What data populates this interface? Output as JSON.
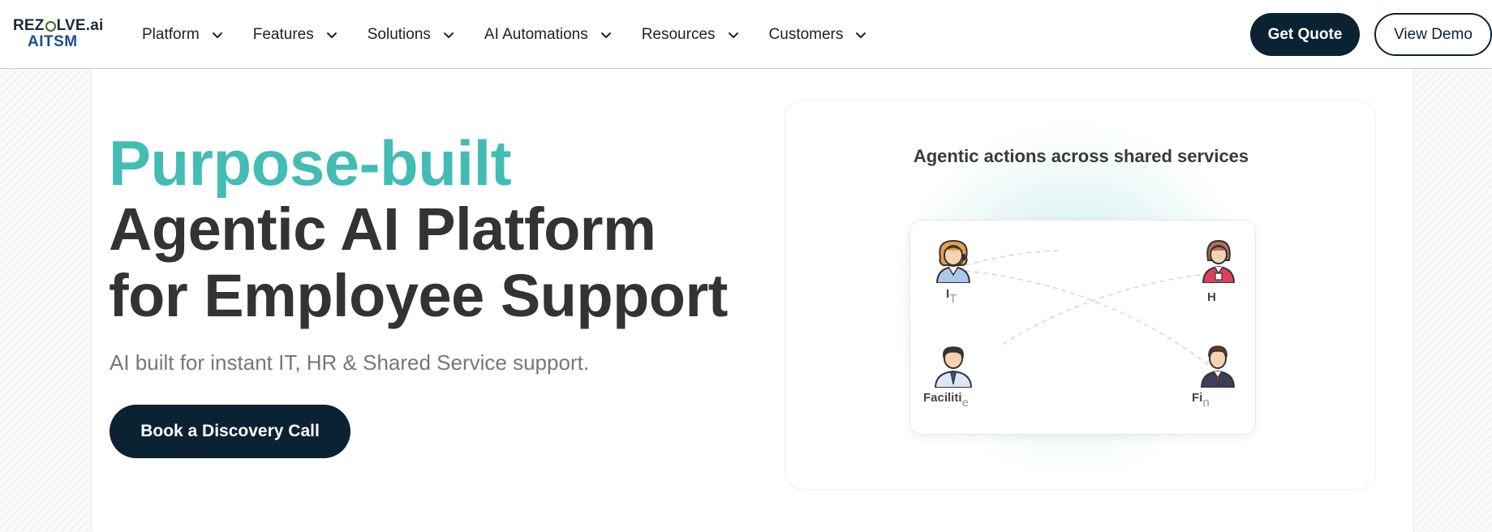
{
  "brand": {
    "logo_top": "REZOLVE.ai",
    "logo_top_a": "REZ",
    "logo_top_b": "LVE.ai",
    "logo_bottom": "AITSM"
  },
  "nav": {
    "items": [
      {
        "label": "Platform"
      },
      {
        "label": "Features"
      },
      {
        "label": "Solutions"
      },
      {
        "label": "AI Automations"
      },
      {
        "label": "Resources"
      },
      {
        "label": "Customers"
      }
    ],
    "chevron_icon": "chevron-down-icon"
  },
  "header_actions": {
    "quote_label": "Get Quote",
    "demo_label": "View Demo"
  },
  "hero": {
    "headline_accent": "Purpose-built",
    "headline_line2": "Agentic AI Platform",
    "headline_line3": "for Employee Support",
    "subtitle": "AI built for instant IT, HR & Shared Service support.",
    "cta_label": "Book a Discovery Call"
  },
  "diagram": {
    "title": "Agentic actions across shared services",
    "personas": [
      {
        "label_main": "I",
        "label_tail": "T",
        "icon": "support-agent-icon"
      },
      {
        "label_main": "H",
        "label_tail": "",
        "icon": "hr-woman-icon"
      },
      {
        "label_main": "Faciliti",
        "label_tail": "e",
        "icon": "facilities-man-icon"
      },
      {
        "label_main": "Fi",
        "label_tail": "n",
        "icon": "finance-man-icon"
      }
    ]
  },
  "colors": {
    "accent": "#43bdb4",
    "navy": "#0b2233",
    "text": "#333333",
    "muted": "#777777"
  }
}
